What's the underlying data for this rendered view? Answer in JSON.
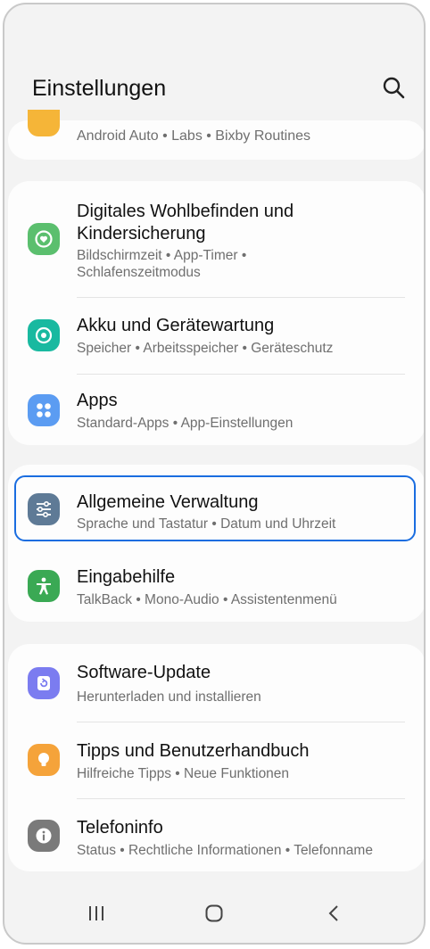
{
  "header": {
    "title": "Einstellungen"
  },
  "top_card": {
    "subtitle": "Android Auto  •  Labs  •  Bixby Routines",
    "icon_color": "#f5b538"
  },
  "groups": [
    {
      "items": [
        {
          "title": "Digitales Wohlbefinden und\nKindersicherung",
          "subtitle": "Bildschirmzeit  •  App-Timer  •\nSchlafenszeitmodus",
          "icon": "digital-wellbeing-icon",
          "color": "#5bbf6e"
        },
        {
          "title": "Akku und Gerätewartung",
          "subtitle": "Speicher  •  Arbeitsspeicher  •  Geräteschutz",
          "icon": "device-care-icon",
          "color": "#19b9a0"
        },
        {
          "title": "Apps",
          "subtitle": "Standard-Apps  •  App-Einstellungen",
          "icon": "apps-icon",
          "color": "#5b9cf2"
        }
      ]
    },
    {
      "items": [
        {
          "title": "Allgemeine Verwaltung",
          "subtitle": "Sprache und Tastatur  •  Datum und Uhrzeit",
          "icon": "sliders-icon",
          "color": "#5e7a96"
        },
        {
          "title": "Eingabehilfe",
          "subtitle": "TalkBack  •  Mono-Audio  •  Assistentenmenü",
          "icon": "accessibility-icon",
          "color": "#3aa954"
        }
      ]
    },
    {
      "items": [
        {
          "title": "Software-Update",
          "subtitle": "Herunterladen und installieren",
          "icon": "software-update-icon",
          "color": "#7b7cf0"
        },
        {
          "title": "Tipps und Benutzerhandbuch",
          "subtitle": "Hilfreiche Tipps  •  Neue Funktionen",
          "icon": "tips-icon",
          "color": "#f5a33a"
        },
        {
          "title": "Telefoninfo",
          "subtitle": "Status  •  Rechtliche Informationen  •  Telefonname",
          "icon": "info-icon",
          "color": "#7a7a7a"
        }
      ]
    }
  ],
  "highlight_color": "#1a6de0"
}
